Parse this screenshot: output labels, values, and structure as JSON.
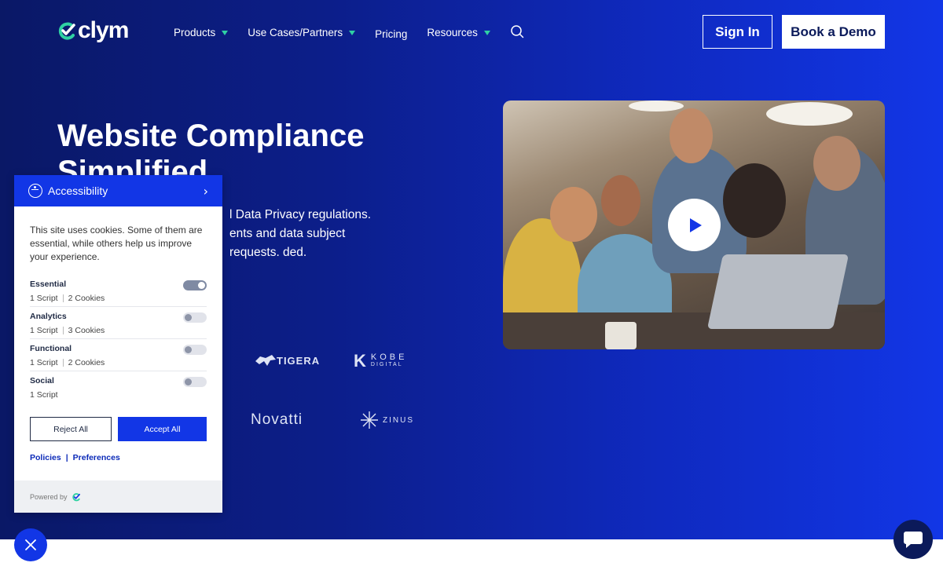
{
  "brand": {
    "name": "clym",
    "accent": "#2fd1a3",
    "primary": "#1236e6"
  },
  "nav": {
    "items": [
      {
        "label": "Products",
        "dropdown": true
      },
      {
        "label": "Use Cases/Partners",
        "dropdown": true
      },
      {
        "label": "Pricing",
        "dropdown": false
      },
      {
        "label": "Resources",
        "dropdown": true
      }
    ],
    "search_icon": "search-icon",
    "signin_label": "Sign In",
    "demo_label": "Book a Demo"
  },
  "hero": {
    "title": "Website Compliance Simplified",
    "description_visible": "l Data Privacy regulations. ents and data subject requests. ded."
  },
  "client_logos": [
    "TIGERA",
    "KOBE",
    "DIGITAL",
    "Novatti",
    "ZINUS"
  ],
  "video": {
    "play_icon": "play-icon"
  },
  "cookie_panel": {
    "accessibility_label": "Accessibility",
    "intro": "This site uses cookies. Some of them are essential, while others help us improve your experience.",
    "categories": [
      {
        "name": "Essential",
        "scripts": "1 Script",
        "cookies": "2 Cookies",
        "enabled": true
      },
      {
        "name": "Analytics",
        "scripts": "1 Script",
        "cookies": "3 Cookies",
        "enabled": false
      },
      {
        "name": "Functional",
        "scripts": "1 Script",
        "cookies": "2 Cookies",
        "enabled": false
      },
      {
        "name": "Social",
        "scripts": "1 Script",
        "cookies": "",
        "enabled": false
      }
    ],
    "reject_label": "Reject All",
    "accept_label": "Accept All",
    "policies_label": "Policies",
    "link_separator": "|",
    "preferences_label": "Preferences",
    "powered_by": "Powered by"
  }
}
